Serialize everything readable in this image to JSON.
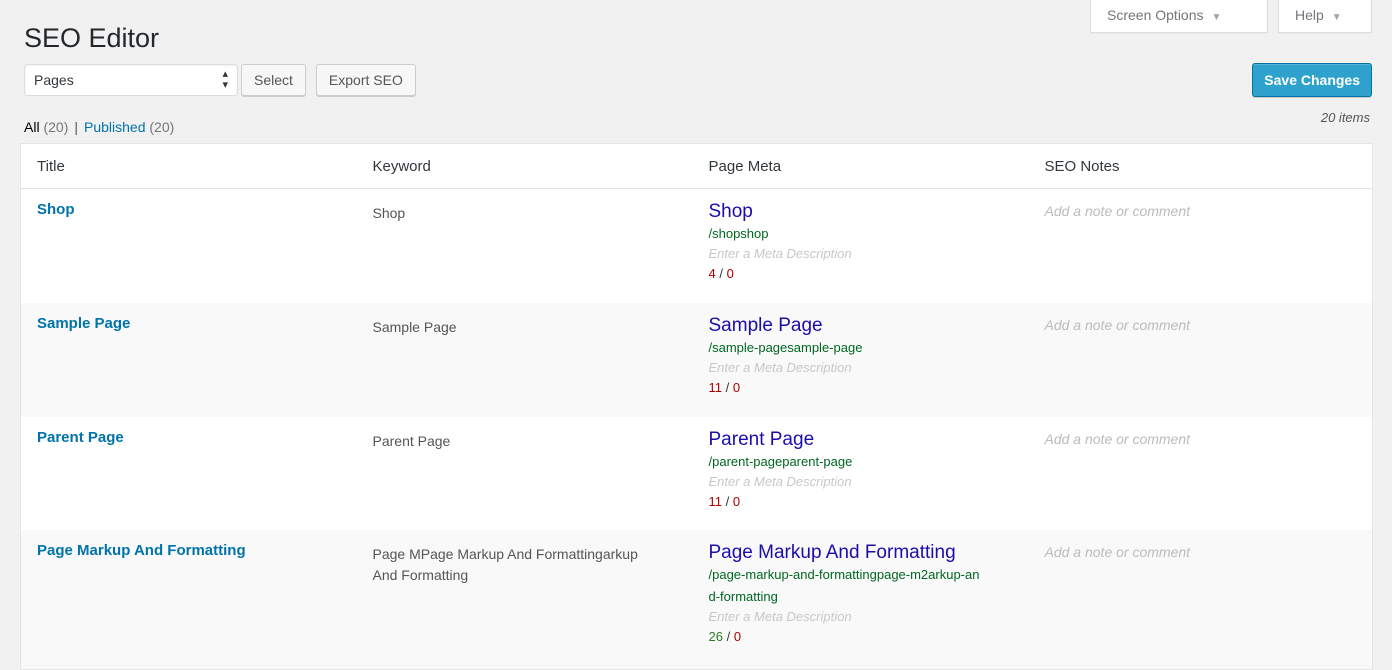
{
  "screen_meta": {
    "screen_options_label": "Screen Options",
    "help_label": "Help",
    "arrow": "▼"
  },
  "page_title": "SEO Editor",
  "toolbar": {
    "post_type_selected": "Pages",
    "select_label": "Select",
    "export_label": "Export SEO",
    "save_label": "Save Changes"
  },
  "views": {
    "all_label": "All",
    "all_count": "(20)",
    "separator": "|",
    "published_label": "Published",
    "published_count": "(20)"
  },
  "displaying_num": "20 items",
  "columns": {
    "title": "Title",
    "keyword": "Keyword",
    "meta": "Page Meta",
    "notes": "SEO Notes"
  },
  "rows": [
    {
      "title": "Shop",
      "keyword": "Shop",
      "meta_title": "Shop",
      "meta_url": "/shopshop",
      "meta_desc_placeholder": "Enter a Meta Description",
      "title_length": "4",
      "count_sep": "/",
      "desc_length": "0",
      "notes_placeholder": "Add a note or comment"
    },
    {
      "title": "Sample Page",
      "keyword": "Sample Page",
      "meta_title": "Sample Page",
      "meta_url": "/sample-pagesample-page",
      "meta_desc_placeholder": "Enter a Meta Description",
      "title_length": "11",
      "count_sep": "/",
      "desc_length": "0",
      "notes_placeholder": "Add a note or comment"
    },
    {
      "title": "Parent Page",
      "keyword": "Parent Page",
      "meta_title": "Parent Page",
      "meta_url": "/parent-pageparent-page",
      "meta_desc_placeholder": "Enter a Meta Description",
      "title_length": "11",
      "count_sep": "/",
      "desc_length": "0",
      "notes_placeholder": "Add a note or comment"
    },
    {
      "title": "Page Markup And Formatting",
      "keyword": "Page MPage Markup And Formattingarkup And Formatting",
      "meta_title": "Page Markup And Formatting",
      "meta_url": "/page-markup-and-formattingpage-m2arkup-and-formatting",
      "meta_desc_placeholder": "Enter a Meta Description",
      "title_length": "26",
      "count_sep": "/",
      "desc_length": "0",
      "notes_placeholder": "Add a note or comment"
    }
  ],
  "colors": {
    "link": "#0073aa",
    "serp_title": "#1a0dab",
    "serp_url": "#006621",
    "count_bad": "#aa0000",
    "count_good": "#2b7a22",
    "primary_button": "#2ea2cc"
  }
}
